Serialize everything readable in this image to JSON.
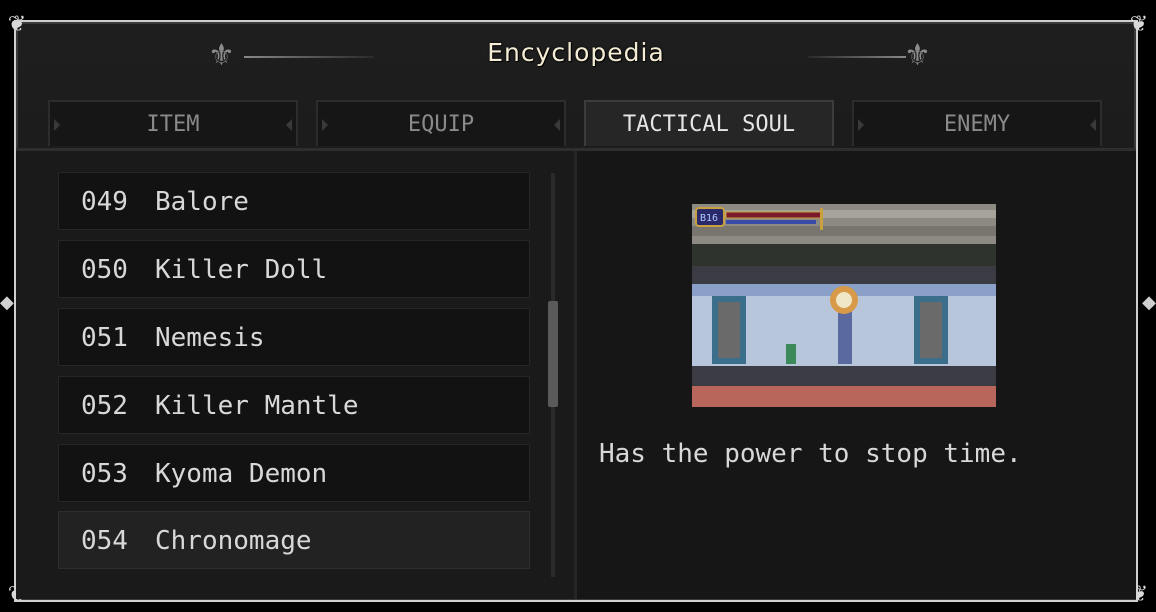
{
  "header": {
    "title": "Encyclopedia"
  },
  "tabs": [
    {
      "label": "ITEM",
      "active": false
    },
    {
      "label": "EQUIP",
      "active": false
    },
    {
      "label": "TACTICAL SOUL",
      "active": true
    },
    {
      "label": "ENEMY",
      "active": false
    }
  ],
  "list": {
    "items": [
      {
        "number": "049",
        "name": "Balore"
      },
      {
        "number": "050",
        "name": "Killer Doll"
      },
      {
        "number": "051",
        "name": "Nemesis"
      },
      {
        "number": "052",
        "name": "Killer Mantle"
      },
      {
        "number": "053",
        "name": "Kyoma Demon"
      },
      {
        "number": "054",
        "name": "Chronomage"
      }
    ],
    "selected_index": 5
  },
  "detail": {
    "description": "Has the power to stop time.",
    "hud_level": "B16"
  },
  "colors": {
    "title_text": "#f4ecd4",
    "active_tab_text": "#e6e6e6",
    "inactive_tab_text": "#8a8a8a",
    "frame_border": "#cfcfcf"
  }
}
